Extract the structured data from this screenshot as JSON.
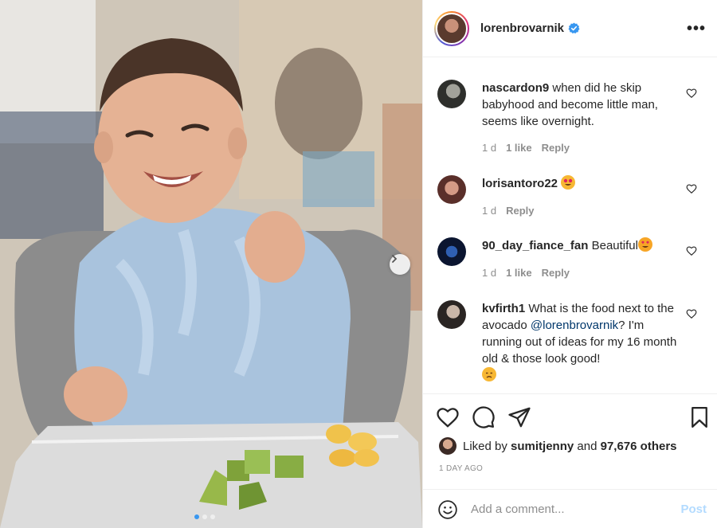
{
  "post": {
    "image_count": 3,
    "active_image": 1
  },
  "header": {
    "username": "lorenbrovarnik",
    "verified": true,
    "more_label": "•••"
  },
  "comments": [
    {
      "username": "nascardon9",
      "text": "when did he skip babyhood and become little man, seems like overnight.",
      "time": "1 d",
      "likes": "1 like",
      "reply": "Reply"
    },
    {
      "username": "lorisantoro22",
      "text": "",
      "time": "1 d",
      "reply": "Reply"
    },
    {
      "username": "90_day_fiance_fan",
      "text": "Beautiful",
      "time": "1 d",
      "likes": "1 like",
      "reply": "Reply"
    },
    {
      "username": "kvfirth1",
      "text_before": "What is the food next to the avocado",
      "mention": "@lorenbrovarnik",
      "text_after": "? I'm running out of ideas for my 16 month old & those look good!"
    }
  ],
  "likes": {
    "prefix": "Liked by",
    "user": "sumitjenny",
    "connector": "and",
    "count": "97,676 others"
  },
  "timestamp": "1 DAY AGO",
  "add_comment": {
    "placeholder": "Add a comment...",
    "post_label": "Post"
  },
  "colors": {
    "verified": "#3897f0",
    "post_disabled": "#b3dbff",
    "muted_text": "#8e8e8e",
    "mention": "#00376b"
  }
}
